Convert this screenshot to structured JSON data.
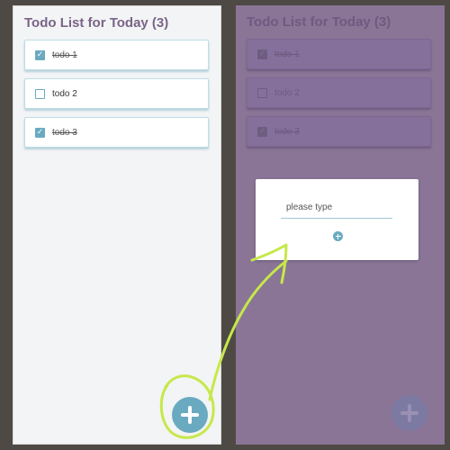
{
  "title": "Todo List for Today (3)",
  "todos": [
    {
      "label": "todo 1",
      "done": true
    },
    {
      "label": "todo 2",
      "done": false
    },
    {
      "label": "todo 3",
      "done": true
    }
  ],
  "modal": {
    "input_placeholder": "please type",
    "add_icon": "plus-icon"
  },
  "fab_icon": "plus-icon",
  "colors": {
    "accent": "#6aaac0",
    "title": "#7a6487",
    "overlay": "#8a7597",
    "annotation": "#c6e84a",
    "background": "#4e4944"
  }
}
